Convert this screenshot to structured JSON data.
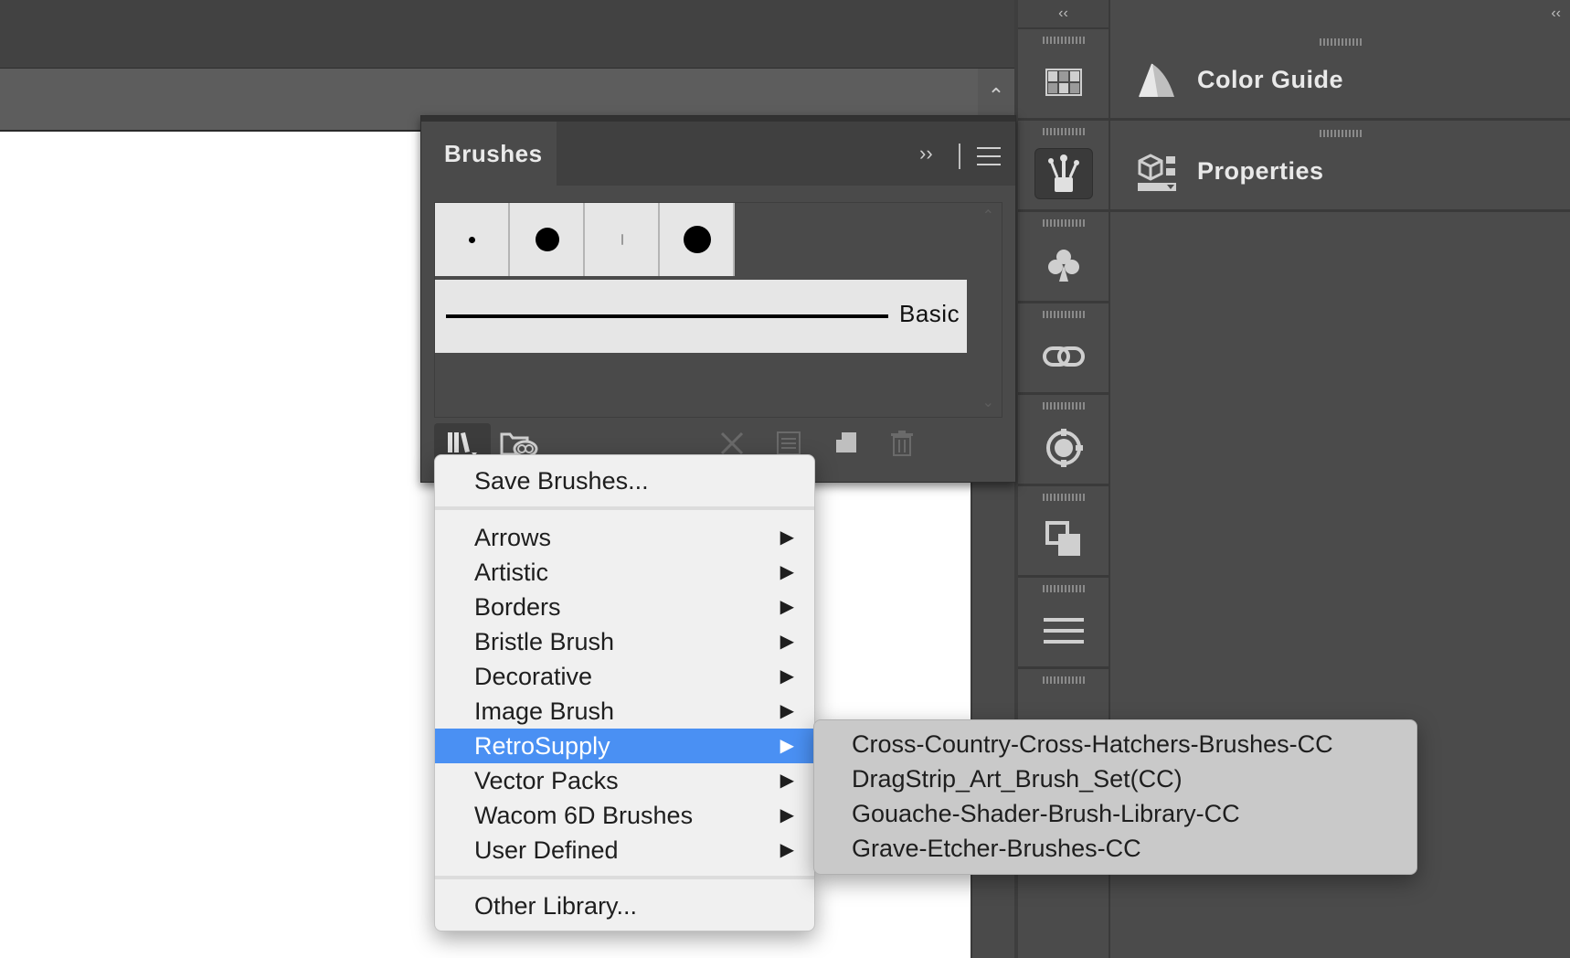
{
  "dock": {
    "collapse_icon": "double-chevron-left-icon",
    "icons": [
      "swatches-icon",
      "brushes-icon",
      "symbols-icon",
      "links-icon",
      "image-trace-icon",
      "pathfinder-icon",
      "align-icon"
    ]
  },
  "right_panel": {
    "collapse_icon": "double-chevron-left-icon",
    "items": [
      {
        "label": "Color Guide",
        "icon": "color-guide-icon"
      },
      {
        "label": "Properties",
        "icon": "properties-icon"
      }
    ]
  },
  "brushes_panel": {
    "title": "Brushes",
    "basic_label": "Basic"
  },
  "library_menu": {
    "save": "Save Brushes...",
    "items": [
      "Arrows",
      "Artistic",
      "Borders",
      "Bristle Brush",
      "Decorative",
      "Image Brush",
      "RetroSupply",
      "Vector Packs",
      "Wacom 6D Brushes",
      "User Defined"
    ],
    "selected": "RetroSupply",
    "other": "Other Library..."
  },
  "submenu": {
    "items": [
      "Cross-Country-Cross-Hatchers-Brushes-CC",
      "DragStrip_Art_Brush_Set(CC)",
      "Gouache-Shader-Brush-Library-CC",
      "Grave-Etcher-Brushes-CC"
    ]
  },
  "colors": {
    "selection": "#4a90f3",
    "ui_dark": "#4b4b4b"
  }
}
